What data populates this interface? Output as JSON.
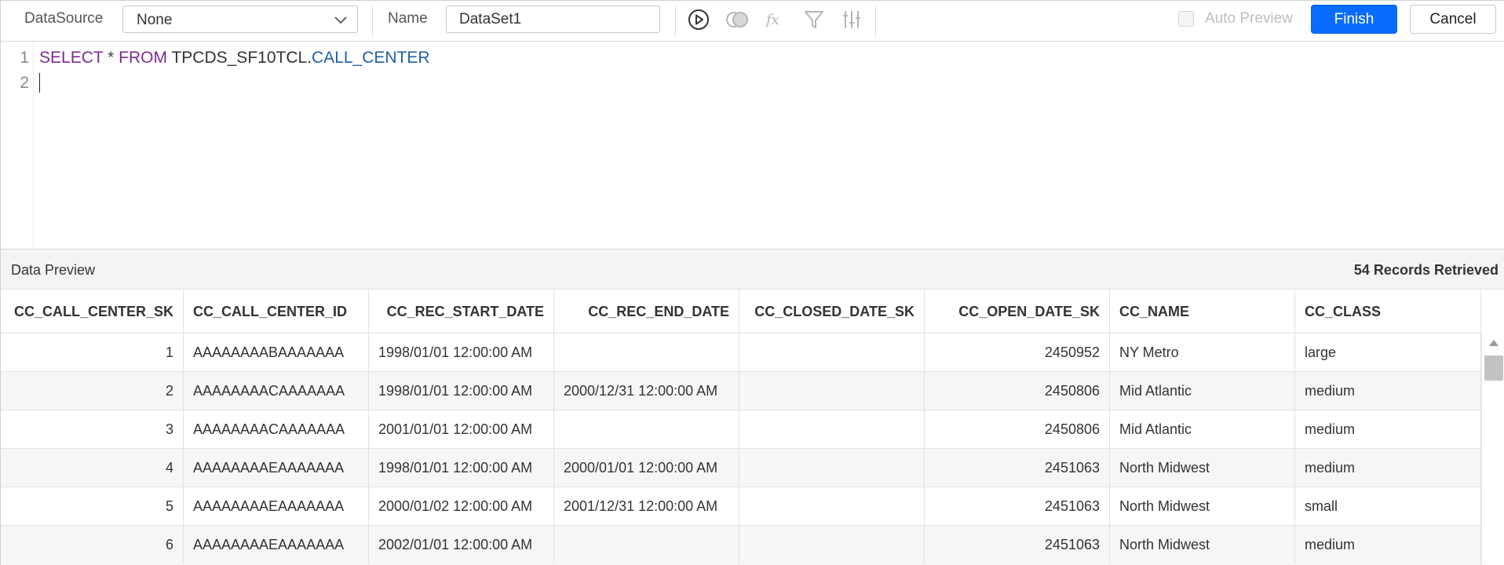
{
  "toolbar": {
    "datasource_label": "DataSource",
    "datasource_value": "None",
    "name_label": "Name",
    "name_value": "DataSet1",
    "auto_preview_label": "Auto Preview",
    "auto_preview_checked": false,
    "finish_label": "Finish",
    "cancel_label": "Cancel",
    "icons": [
      "run-query-icon",
      "join-icon",
      "expression-icon",
      "filter-icon",
      "parameters-icon"
    ],
    "accent_color": "#0a6cff"
  },
  "editor": {
    "line_numbers": [
      "1",
      "2"
    ],
    "line1": {
      "kw_select": "SELECT",
      "op_star": " * ",
      "kw_from": "FROM",
      "schema": " TPCDS_SF10TCL.",
      "table": "CALL_CENTER"
    }
  },
  "preview": {
    "title": "Data Preview",
    "records": "54 Records Retrieved"
  },
  "grid": {
    "columns": [
      "CC_CALL_CENTER_SK",
      "CC_CALL_CENTER_ID",
      "CC_REC_START_DATE",
      "CC_REC_END_DATE",
      "CC_CLOSED_DATE_SK",
      "CC_OPEN_DATE_SK",
      "CC_NAME",
      "CC_CLASS"
    ],
    "rows": [
      [
        "1",
        "AAAAAAAABAAAAAAA",
        "1998/01/01 12:00:00 AM",
        "",
        "",
        "2450952",
        "NY Metro",
        "large"
      ],
      [
        "2",
        "AAAAAAAACAAAAAAA",
        "1998/01/01 12:00:00 AM",
        "2000/12/31 12:00:00 AM",
        "",
        "2450806",
        "Mid Atlantic",
        "medium"
      ],
      [
        "3",
        "AAAAAAAACAAAAAAA",
        "2001/01/01 12:00:00 AM",
        "",
        "",
        "2450806",
        "Mid Atlantic",
        "medium"
      ],
      [
        "4",
        "AAAAAAAAEAAAAAAA",
        "1998/01/01 12:00:00 AM",
        "2000/01/01 12:00:00 AM",
        "",
        "2451063",
        "North Midwest",
        "medium"
      ],
      [
        "5",
        "AAAAAAAAEAAAAAAA",
        "2000/01/02 12:00:00 AM",
        "2001/12/31 12:00:00 AM",
        "",
        "2451063",
        "North Midwest",
        "small"
      ],
      [
        "6",
        "AAAAAAAAEAAAAAAA",
        "2002/01/01 12:00:00 AM",
        "",
        "",
        "2451063",
        "North Midwest",
        "medium"
      ]
    ]
  }
}
